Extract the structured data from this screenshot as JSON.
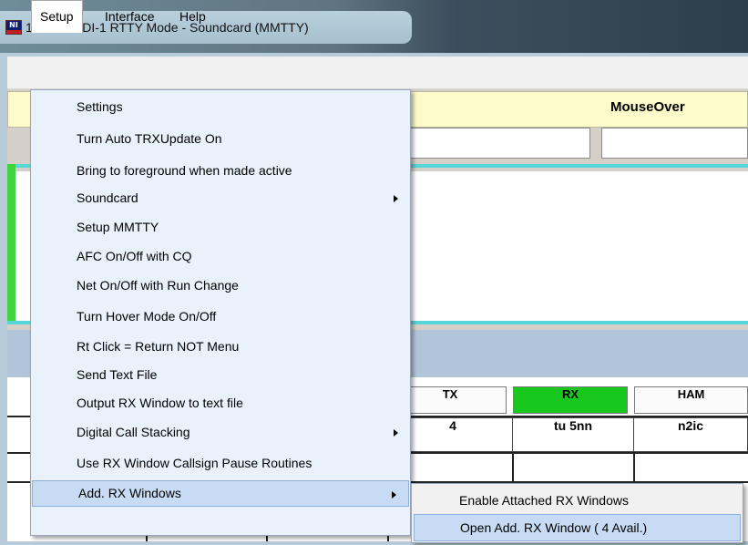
{
  "window": {
    "title": "14078.44  DI-1 RTTY Mode - Soundcard (MMTTY)",
    "icon_text": "NI"
  },
  "menubar": {
    "items": [
      "Setup",
      "Interface",
      "Help"
    ],
    "active": "Setup"
  },
  "app": {
    "mouseover_label": "MouseOver",
    "buttons": [
      "TX",
      "RX",
      "HAM"
    ],
    "cells": [
      "4",
      "tu 5nn",
      "n2ic"
    ],
    "colors": {
      "rx_active": "#19c81d",
      "mouseover_bg": "#fdfbc9",
      "rx_border": "#58d6d8"
    }
  },
  "setup_menu": {
    "items": [
      {
        "label": "Settings"
      },
      {
        "label": "Turn Auto TRXUpdate On"
      },
      {
        "label": "Bring to foreground when made active"
      },
      {
        "label": "Soundcard",
        "submenu": true
      },
      {
        "label": "Setup MMTTY"
      },
      {
        "label": "AFC On/Off with CQ"
      },
      {
        "label": "Net On/Off with Run Change"
      },
      {
        "label": "Turn Hover Mode On/Off"
      },
      {
        "label": "Rt Click = Return NOT Menu"
      },
      {
        "label": "Send Text File"
      },
      {
        "label": "Output RX Window to text file"
      },
      {
        "label": "Digital Call Stacking",
        "submenu": true
      },
      {
        "label": "Use RX Window Callsign Pause Routines"
      },
      {
        "label": "Add. RX Windows",
        "submenu": true,
        "highlighted": true
      }
    ]
  },
  "submenu": {
    "items": [
      {
        "label": "Enable Attached RX Windows"
      },
      {
        "label": "Open Add. RX Window ( 4 Avail.)",
        "highlighted": true
      }
    ]
  }
}
